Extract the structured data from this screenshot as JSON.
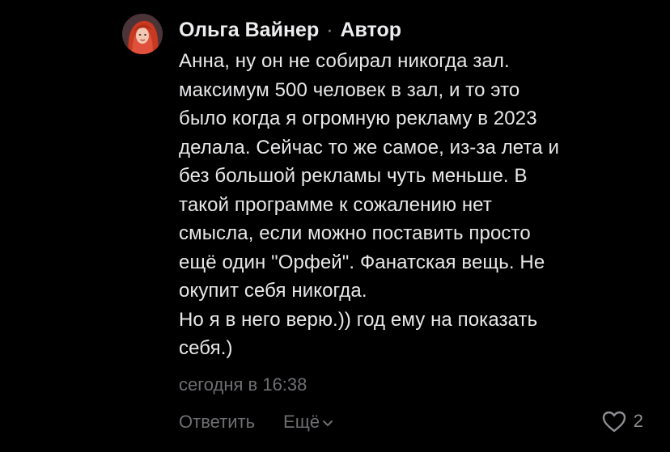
{
  "comment": {
    "author": "Ольга Вайнер",
    "separator": "·",
    "role_badge": "Автор",
    "text": "Анна, ну он не собирал никогда зал.\nмаксимум 500 человек в зал, и то это\nбыло когда я огромную рекламу в 2023\nделала. Сейчас то же самое, из-за лета и\nбез большой рекламы чуть меньше. В\nтакой программе к сожалению нет\nсмысла, если можно поставить просто\nещё один \"Орфей\". Фанатская вещь. Не\nокупит себя никогда.\nНо я в него верю.)) год ему на показать\nсебя.)",
    "timestamp": "сегодня в 16:38",
    "actions": {
      "reply_label": "Ответить",
      "more_label": "Ещё",
      "more_icon": "chevron-down-icon",
      "like_icon": "heart-outline-icon",
      "like_count": "2"
    }
  },
  "colors": {
    "background": "#000000",
    "text_primary": "#e8e8ea",
    "text_secondary": "#6e6e73",
    "avatar_hair": "#d8402a"
  }
}
